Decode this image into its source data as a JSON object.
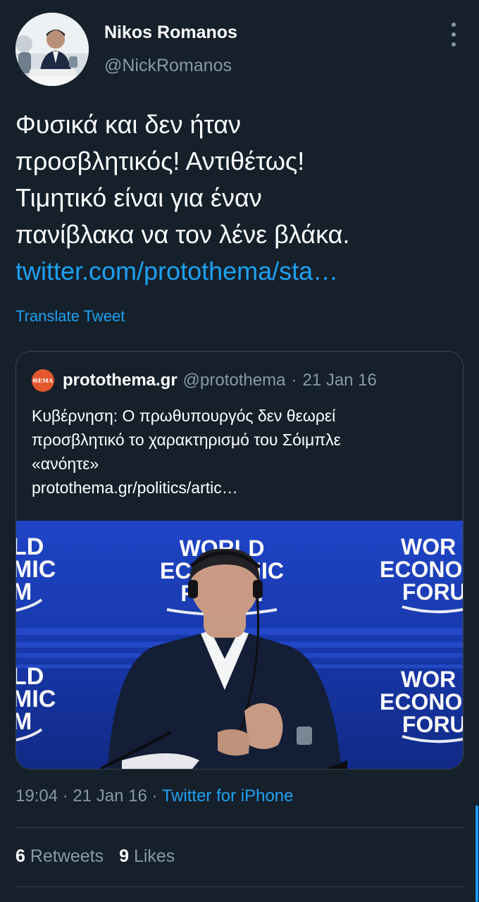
{
  "tweet": {
    "author_name": "Nikos Romanos",
    "author_handle": "@NickRomanos",
    "text_lines": [
      "Φυσικά και δεν ήταν",
      "προσβλητικός! Αντιθέτως!",
      "Τιμητικό είναι για έναν",
      "πανίβλακα να τον λένε βλάκα."
    ],
    "link": "twitter.com/protothema/sta…",
    "translate_label": "Translate Tweet",
    "time": "19:04",
    "date": "21 Jan 16",
    "source": "Twitter for iPhone",
    "retweets_count": "6",
    "retweets_label": "Retweets",
    "likes_count": "9",
    "likes_label": "Likes"
  },
  "quoted": {
    "logo_text": "ΘΕΜΑ",
    "name": "protothema.gr",
    "handle": "@protothema",
    "date": "21 Jan 16",
    "text_lines": [
      "Κυβέρνηση: Ο πρωθυπουργός δεν θεωρεί",
      "προσβλητικό το χαρακτηρισμό του Σόιμπλε",
      "«ανόητε»"
    ],
    "link": "protothema.gr/politics/artic…",
    "image_banners": {
      "left_lines": [
        "LD",
        "MIC",
        "M"
      ],
      "center_lines": [
        "WORLD",
        "ECONOMIC",
        "FORUM"
      ],
      "right_lines": [
        "WOR",
        "ECONO",
        "FORU"
      ]
    }
  },
  "separator": "·",
  "colors": {
    "background": "#15202b",
    "accent": "#1da1f2",
    "muted": "#8899a6",
    "border": "#38444d"
  }
}
